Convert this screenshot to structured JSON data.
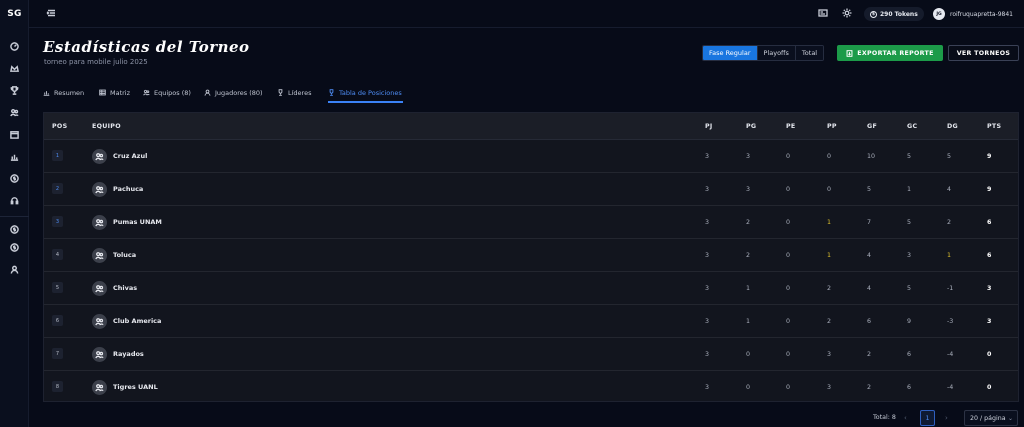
{
  "app": {
    "logo": "SG"
  },
  "header": {
    "tokens_label": "290 Tokens",
    "coin_glyph": "$",
    "user_initials": "JG",
    "username": "roifruquapretta-9841"
  },
  "page": {
    "title": "Estadísticas del Torneo",
    "subtitle": "torneo para mobile julio 2025"
  },
  "phase_toggle": [
    "Fase Regular",
    "Playoffs",
    "Total"
  ],
  "phase_active": 0,
  "actions": {
    "export": "EXPORTAR REPORTE",
    "tournaments": "VER TORNEOS"
  },
  "tabs": [
    {
      "label": "Resumen",
      "icon": "chart-icon"
    },
    {
      "label": "Matriz",
      "icon": "grid-icon"
    },
    {
      "label": "Equipos (8)",
      "icon": "team-icon"
    },
    {
      "label": "Jugadores (80)",
      "icon": "user-icon"
    },
    {
      "label": "Líderes",
      "icon": "trophy-icon"
    },
    {
      "label": "Tabla de Posiciones",
      "icon": "trophy-icon"
    }
  ],
  "tab_active": 5,
  "table": {
    "headers": [
      "POS",
      "EQUIPO",
      "PJ",
      "PG",
      "PE",
      "PP",
      "GF",
      "GC",
      "DG",
      "PTS"
    ],
    "rows": [
      {
        "pos": "1",
        "team": "Cruz Azul",
        "pj": "3",
        "pg": "3",
        "pe": "0",
        "pp": "0",
        "gf": "10",
        "gc": "5",
        "dg": "5",
        "pts": "9"
      },
      {
        "pos": "2",
        "team": "Pachuca",
        "pj": "3",
        "pg": "3",
        "pe": "0",
        "pp": "0",
        "gf": "5",
        "gc": "1",
        "dg": "4",
        "pts": "9"
      },
      {
        "pos": "3",
        "team": "Pumas UNAM",
        "pj": "3",
        "pg": "2",
        "pe": "0",
        "pp": "1",
        "gf": "7",
        "gc": "5",
        "dg": "2",
        "pts": "6"
      },
      {
        "pos": "4",
        "team": "Toluca",
        "pj": "3",
        "pg": "2",
        "pe": "0",
        "pp": "1",
        "gf": "4",
        "gc": "3",
        "dg": "1",
        "pts": "6"
      },
      {
        "pos": "5",
        "team": "Chivas",
        "pj": "3",
        "pg": "1",
        "pe": "0",
        "pp": "2",
        "gf": "4",
        "gc": "5",
        "dg": "-1",
        "pts": "3"
      },
      {
        "pos": "6",
        "team": "Club America",
        "pj": "3",
        "pg": "1",
        "pe": "0",
        "pp": "2",
        "gf": "6",
        "gc": "9",
        "dg": "-3",
        "pts": "3"
      },
      {
        "pos": "7",
        "team": "Rayados",
        "pj": "3",
        "pg": "0",
        "pe": "0",
        "pp": "3",
        "gf": "2",
        "gc": "6",
        "dg": "-4",
        "pts": "0"
      },
      {
        "pos": "8",
        "team": "Tigres UANL",
        "pj": "3",
        "pg": "0",
        "pe": "0",
        "pp": "3",
        "gf": "2",
        "gc": "6",
        "dg": "-4",
        "pts": "0"
      }
    ]
  },
  "pagination": {
    "total_label": "Total: 8",
    "prev": "‹",
    "current": "1",
    "next": "›",
    "page_size": "20 / página",
    "chevron": "⌄"
  },
  "colors": {
    "accent": "#3b82f6",
    "export_green": "#1c9b49",
    "highlight_yellow": "#e0c22d",
    "background": "#070b18"
  }
}
